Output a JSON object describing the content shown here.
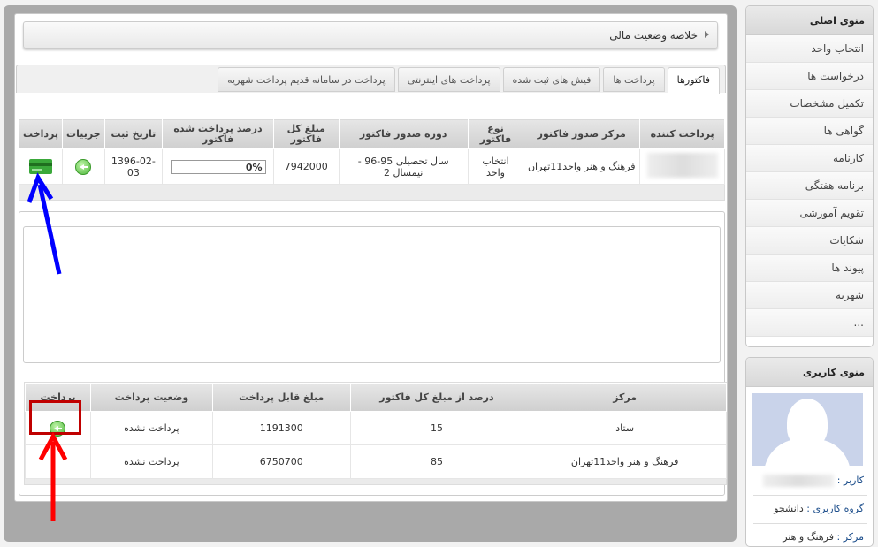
{
  "breadcrumb": {
    "title": "خلاصه وضعیت مالی"
  },
  "tabs": [
    {
      "label": "فاکتورها"
    },
    {
      "label": "پرداخت ها"
    },
    {
      "label": "فیش های ثبت شده"
    },
    {
      "label": "پرداخت های اینترنتی"
    },
    {
      "label": "پرداخت در سامانه قدیم پرداخت شهریه"
    }
  ],
  "invoices": {
    "headers": [
      "پرداخت کننده",
      "مرکز صدور فاکتور",
      "نوع فاکتور",
      "دوره صدور فاکتور",
      "مبلغ کل فاکتور",
      "درصد پرداخت شده فاکتور",
      "تاریخ ثبت",
      "جزییات",
      "پرداخت"
    ],
    "row": {
      "center": "فرهنگ و هنر واحد11تهران",
      "type": "انتخاب واحد",
      "period": "سال تحصیلی 95-96 - نیمسال 2",
      "amount": "7942000",
      "percent": "0%",
      "date": "1396-02-03"
    }
  },
  "payments": {
    "headers": [
      "مرکز",
      "درصد از مبلغ کل فاکتور",
      "مبلغ قابل پرداخت",
      "وضعیت پرداخت",
      "پرداخت"
    ],
    "rows": [
      {
        "center": "ستاد",
        "percent": "15",
        "amount": "1191300",
        "status": "پرداخت نشده"
      },
      {
        "center": "فرهنگ و هنر واحد11تهران",
        "percent": "85",
        "amount": "6750700",
        "status": "پرداخت نشده"
      }
    ]
  },
  "main_menu": {
    "title": "منوی اصلی",
    "items": [
      "انتخاب واحد",
      "درخواست ها",
      "تکمیل مشخصات",
      "گواهی ها",
      "کارنامه",
      "برنامه هفتگی",
      "تقویم آموزشی",
      "شکایات",
      "پیوند ها",
      "شهریه",
      "..."
    ]
  },
  "user_menu": {
    "title": "منوی کاربری",
    "user_label": "کاربر :",
    "group_label": "گروه کاربری :",
    "group_value": "دانشجو",
    "center_label": "مرکز :",
    "center_value": "فرهنگ و هنر"
  },
  "annotations": {
    "blue_arrow_color": "#0000ff",
    "red_arrow_color": "#ff0000",
    "highlight_color": "#c00000"
  }
}
